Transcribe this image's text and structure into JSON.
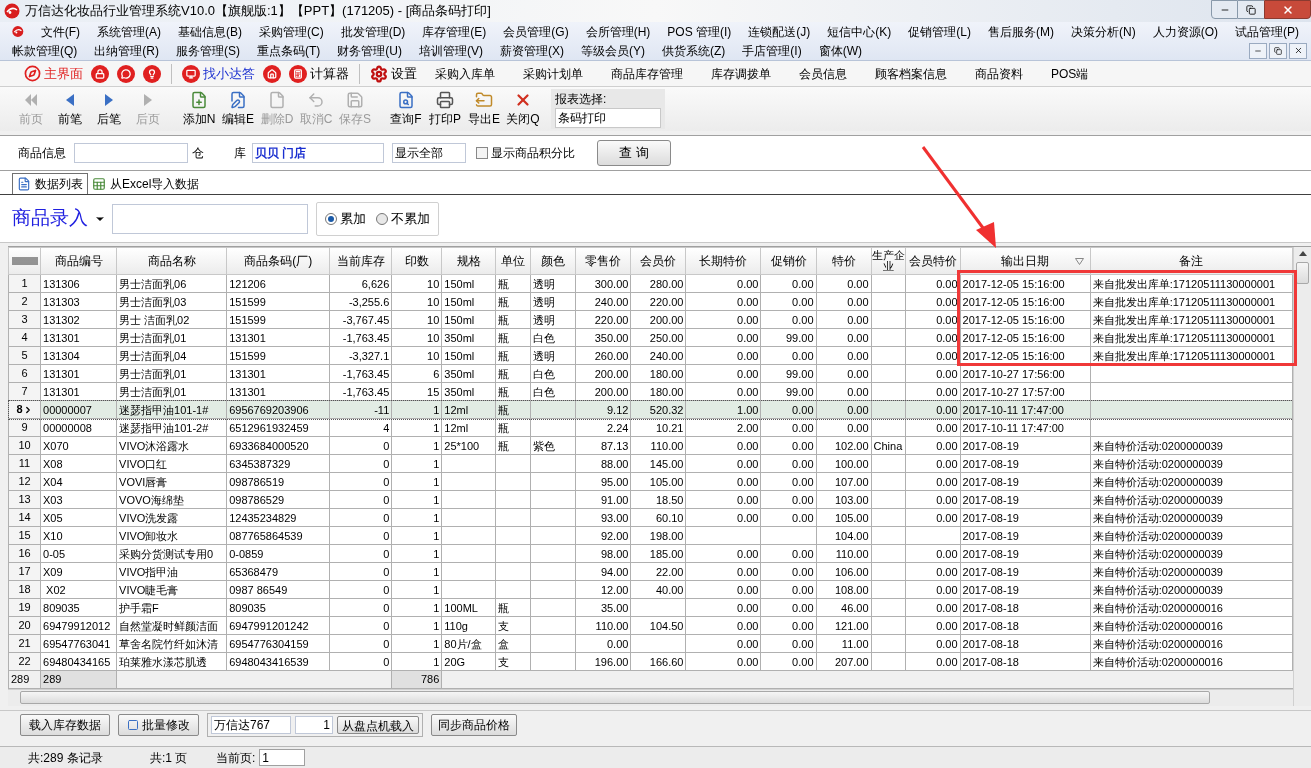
{
  "window": {
    "title": "万信达化妆品行业管理系统V10.0【旗舰版:1】【PPT】(171205) - [商品条码打印]"
  },
  "menu_rows": [
    [
      "文件(F)",
      "系统管理(A)",
      "基础信息(B)",
      "采购管理(C)",
      "批发管理(D)",
      "库存管理(E)",
      "会员管理(G)",
      "会所管理(H)",
      "POS 管理(I)",
      "连锁配送(J)",
      "短信中心(K)",
      "促销管理(L)",
      "售后服务(M)",
      "决策分析(N)",
      "人力资源(O)",
      "试品管理(P)"
    ],
    [
      "帐款管理(Q)",
      "出纳管理(R)",
      "服务管理(S)",
      "重点条码(T)",
      "财务管理(U)",
      "培训管理(V)",
      "薪资管理(X)",
      "等级会员(Y)",
      "供货系统(Z)",
      "手店管理(I)",
      "窗体(W)"
    ]
  ],
  "quick_bar": [
    {
      "label": "主界面",
      "kind": "home"
    },
    {
      "kind": "lock"
    },
    {
      "kind": "chat"
    },
    {
      "kind": "bulb"
    },
    {
      "label": "找小达答",
      "kind": "help"
    },
    {
      "kind": "house"
    },
    {
      "label": "计算器",
      "kind": "calc"
    },
    {
      "label": "设置",
      "kind": "gear"
    },
    {
      "label": "采购入库单",
      "kind": "text"
    },
    {
      "label": "采购计划单",
      "kind": "text"
    },
    {
      "label": "商品库存管理",
      "kind": "text"
    },
    {
      "label": "库存调拨单",
      "kind": "text"
    },
    {
      "label": "会员信息",
      "kind": "text"
    },
    {
      "label": "顾客档案信息",
      "kind": "text"
    },
    {
      "label": "商品资料",
      "kind": "text"
    },
    {
      "label": "POS端",
      "kind": "text"
    }
  ],
  "toolbar": [
    {
      "label": "前页",
      "kind": "first",
      "disabled": true
    },
    {
      "label": "前笔",
      "kind": "prev",
      "disabled": false
    },
    {
      "label": "后笔",
      "kind": "next",
      "disabled": false
    },
    {
      "label": "后页",
      "kind": "last",
      "disabled": true
    },
    {
      "label": "添加N",
      "kind": "add",
      "disabled": false
    },
    {
      "label": "编辑E",
      "kind": "edit",
      "disabled": false
    },
    {
      "label": "删除D",
      "kind": "delete",
      "disabled": true
    },
    {
      "label": "取消C",
      "kind": "undo",
      "disabled": true
    },
    {
      "label": "保存S",
      "kind": "save",
      "disabled": true
    },
    {
      "label": "查询F",
      "kind": "find",
      "disabled": false
    },
    {
      "label": "打印P",
      "kind": "print",
      "disabled": false
    },
    {
      "label": "导出E",
      "kind": "export",
      "disabled": false
    },
    {
      "label": "关闭Q",
      "kind": "close",
      "disabled": false
    }
  ],
  "report_select": {
    "label": "报表选择:",
    "value": "条码打印"
  },
  "filter": {
    "product_label": "商品信息",
    "warehouse_label_1": "仓",
    "warehouse_label_2": "库",
    "warehouse_value": "贝贝 门店",
    "show_value": "显示全部",
    "checkbox": {
      "label": "显示商品积分比",
      "checked": false
    },
    "query_button": "查 询"
  },
  "tabs": [
    {
      "label": "数据列表",
      "selected": true
    },
    {
      "label": "从Excel导入数据",
      "selected": false
    }
  ],
  "entry": {
    "label": "商品录入",
    "radios": [
      {
        "label": "累加",
        "selected": true
      },
      {
        "label": "不累加",
        "selected": false
      }
    ]
  },
  "table": {
    "columns": [
      "商品编号",
      "商品名称",
      "商品条码(厂)",
      "当前库存",
      "印数",
      "规格",
      "单位",
      "颜色",
      "零售价",
      "会员价",
      "长期特价",
      "促销价",
      "特价",
      "生产企业",
      "会员特价",
      "输出日期",
      "备注"
    ],
    "rows": [
      {
        "no": "1",
        "selected": false,
        "cells": [
          "131306",
          "男士洁面乳06",
          "121206",
          "6,626",
          "10",
          "150ml",
          "瓶",
          "透明",
          "300.00",
          "280.00",
          "0.00",
          "0.00",
          "0.00",
          "",
          "0.00",
          "2017-12-05 15:16:00",
          "来自批发出库单:17120511130000001"
        ]
      },
      {
        "no": "2",
        "selected": false,
        "cells": [
          "131303",
          "男士洁面乳03",
          "151599",
          "-3,255.6",
          "10",
          "150ml",
          "瓶",
          "透明",
          "240.00",
          "220.00",
          "0.00",
          "0.00",
          "0.00",
          "",
          "0.00",
          "2017-12-05 15:16:00",
          "来自批发出库单:17120511130000001"
        ]
      },
      {
        "no": "3",
        "selected": false,
        "cells": [
          "131302",
          "男士 洁面乳02",
          "151599",
          "-3,767.45",
          "10",
          "150ml",
          "瓶",
          "透明",
          "220.00",
          "200.00",
          "0.00",
          "0.00",
          "0.00",
          "",
          "0.00",
          "2017-12-05 15:16:00",
          "来自批发出库单:17120511130000001"
        ]
      },
      {
        "no": "4",
        "selected": false,
        "cells": [
          "131301",
          "男士洁面乳01",
          "131301",
          "-1,763.45",
          "10",
          "350ml",
          "瓶",
          "白色",
          "350.00",
          "250.00",
          "0.00",
          "99.00",
          "0.00",
          "",
          "0.00",
          "2017-12-05 15:16:00",
          "来自批发出库单:17120511130000001"
        ]
      },
      {
        "no": "5",
        "selected": false,
        "cells": [
          "131304",
          "男士洁面乳04",
          "151599",
          "-3,327.1",
          "10",
          "150ml",
          "瓶",
          "透明",
          "260.00",
          "240.00",
          "0.00",
          "0.00",
          "0.00",
          "",
          "0.00",
          "2017-12-05 15:16:00",
          "来自批发出库单:17120511130000001"
        ]
      },
      {
        "no": "6",
        "selected": false,
        "cells": [
          "131301",
          "男士洁面乳01",
          "131301",
          "-1,763.45",
          "6",
          "350ml",
          "瓶",
          "白色",
          "200.00",
          "180.00",
          "0.00",
          "99.00",
          "0.00",
          "",
          "0.00",
          "2017-10-27 17:56:00",
          ""
        ]
      },
      {
        "no": "7",
        "selected": false,
        "cells": [
          "131301",
          "男士洁面乳01",
          "131301",
          "-1,763.45",
          "15",
          "350ml",
          "瓶",
          "白色",
          "200.00",
          "180.00",
          "0.00",
          "99.00",
          "0.00",
          "",
          "0.00",
          "2017-10-27 17:57:00",
          ""
        ]
      },
      {
        "no": "8",
        "selected": true,
        "cells": [
          "00000007",
          "迷瑟指甲油101-1#",
          "6956769203906",
          "-11",
          "1",
          "12ml",
          "瓶",
          "",
          "9.12",
          "520.32",
          "1.00",
          "0.00",
          "0.00",
          "",
          "0.00",
          "2017-10-11 17:47:00",
          ""
        ]
      },
      {
        "no": "9",
        "selected": false,
        "cells": [
          "00000008",
          "迷瑟指甲油101-2#",
          "6512961932459",
          "4",
          "1",
          "12ml",
          "瓶",
          "",
          "2.24",
          "10.21",
          "2.00",
          "0.00",
          "0.00",
          "",
          "0.00",
          "2017-10-11 17:47:00",
          ""
        ]
      },
      {
        "no": "10",
        "selected": false,
        "cells": [
          "X070",
          "VIVO沐浴露水",
          "6933684000520",
          "0",
          "1",
          "25*100",
          "瓶",
          "紫色",
          "87.13",
          "110.00",
          "0.00",
          "0.00",
          "102.00",
          "China",
          "0.00",
          "2017-08-19",
          "来自特价活动:0200000039"
        ]
      },
      {
        "no": "11",
        "selected": false,
        "cells": [
          "X08",
          "VIVO口红",
          "6345387329",
          "0",
          "1",
          "",
          "",
          "",
          "88.00",
          "145.00",
          "0.00",
          "0.00",
          "100.00",
          "",
          "0.00",
          "2017-08-19",
          "来自特价活动:0200000039"
        ]
      },
      {
        "no": "12",
        "selected": false,
        "cells": [
          "X04",
          "VOVI唇膏",
          "098786519",
          "0",
          "1",
          "",
          "",
          "",
          "95.00",
          "105.00",
          "0.00",
          "0.00",
          "107.00",
          "",
          "0.00",
          "2017-08-19",
          "来自特价活动:0200000039"
        ]
      },
      {
        "no": "13",
        "selected": false,
        "cells": [
          "X03",
          "VOVO海绵垫",
          "098786529",
          "0",
          "1",
          "",
          "",
          "",
          "91.00",
          "18.50",
          "0.00",
          "0.00",
          "103.00",
          "",
          "0.00",
          "2017-08-19",
          "来自特价活动:0200000039"
        ]
      },
      {
        "no": "14",
        "selected": false,
        "cells": [
          "X05",
          "VIVO洗发露",
          "12435234829",
          "0",
          "1",
          "",
          "",
          "",
          "93.00",
          "60.10",
          "0.00",
          "0.00",
          "105.00",
          "",
          "0.00",
          "2017-08-19",
          "来自特价活动:0200000039"
        ]
      },
      {
        "no": "15",
        "selected": false,
        "cells": [
          "X10",
          "VIVO卸妆水",
          "087765864539",
          "0",
          "1",
          "",
          "",
          "",
          "92.00",
          "198.00",
          "",
          "",
          "104.00",
          "",
          "",
          "2017-08-19",
          "来自特价活动:0200000039"
        ]
      },
      {
        "no": "16",
        "selected": false,
        "cells": [
          "0-05",
          "采购分货测试专用0",
          "0-0859",
          "0",
          "1",
          "",
          "",
          "",
          "98.00",
          "185.00",
          "0.00",
          "0.00",
          "110.00",
          "",
          "0.00",
          "2017-08-19",
          "来自特价活动:0200000039"
        ]
      },
      {
        "no": "17",
        "selected": false,
        "cells": [
          "X09",
          "VIVO指甲油",
          "65368479",
          "0",
          "1",
          "",
          "",
          "",
          "94.00",
          "22.00",
          "0.00",
          "0.00",
          "106.00",
          "",
          "0.00",
          "2017-08-19",
          "来自特价活动:0200000039"
        ]
      },
      {
        "no": "18",
        "selected": false,
        "cells": [
          " X02",
          "VIVO睫毛膏",
          "0987 86549",
          "0",
          "1",
          "",
          "",
          "",
          "12.00",
          "40.00",
          "0.00",
          "0.00",
          "108.00",
          "",
          "0.00",
          "2017-08-19",
          "来自特价活动:0200000039"
        ]
      },
      {
        "no": "19",
        "selected": false,
        "cells": [
          "809035",
          "护手霜F",
          "809035",
          "0",
          "1",
          "100ML",
          "瓶",
          "",
          "35.00",
          "",
          "0.00",
          "0.00",
          "46.00",
          "",
          "0.00",
          "2017-08-18",
          "来自特价活动:0200000016"
        ]
      },
      {
        "no": "20",
        "selected": false,
        "cells": [
          "69479912012",
          "自然堂凝时鲜颜洁面",
          "6947991201242",
          "0",
          "1",
          "110g",
          "支",
          "",
          "110.00",
          "104.50",
          "0.00",
          "0.00",
          "121.00",
          "",
          "0.00",
          "2017-08-18",
          "来自特价活动:0200000016"
        ]
      },
      {
        "no": "21",
        "selected": false,
        "cells": [
          "69547763041",
          "草舍名院竹纤如沐清",
          "6954776304159",
          "0",
          "1",
          "80片/盒",
          "盒",
          "",
          "0.00",
          "",
          "0.00",
          "0.00",
          "11.00",
          "",
          "0.00",
          "2017-08-18",
          "来自特价活动:0200000016"
        ]
      },
      {
        "no": "22",
        "selected": false,
        "cells": [
          "69480434165",
          "珀莱雅水漾芯肌透",
          "6948043416539",
          "0",
          "1",
          "20G",
          "支",
          "",
          "196.00",
          "166.60",
          "0.00",
          "0.00",
          "207.00",
          "",
          "0.00",
          "2017-08-18",
          "来自特价活动:0200000016"
        ]
      }
    ],
    "footer": {
      "row_count": "289",
      "code_count": "289",
      "prints_total": "786"
    }
  },
  "bottom_bar": {
    "load_button": "载入库存数据",
    "batch_button": "批量修改",
    "device_value": "万信达767",
    "count_value": "1",
    "device_button": "从盘点机载入",
    "sync_button": "同步商品价格"
  },
  "status_bar": {
    "records": "共:289 条记录",
    "pages": "共:1 页",
    "current_label": "当前页:",
    "current_value": "1"
  }
}
